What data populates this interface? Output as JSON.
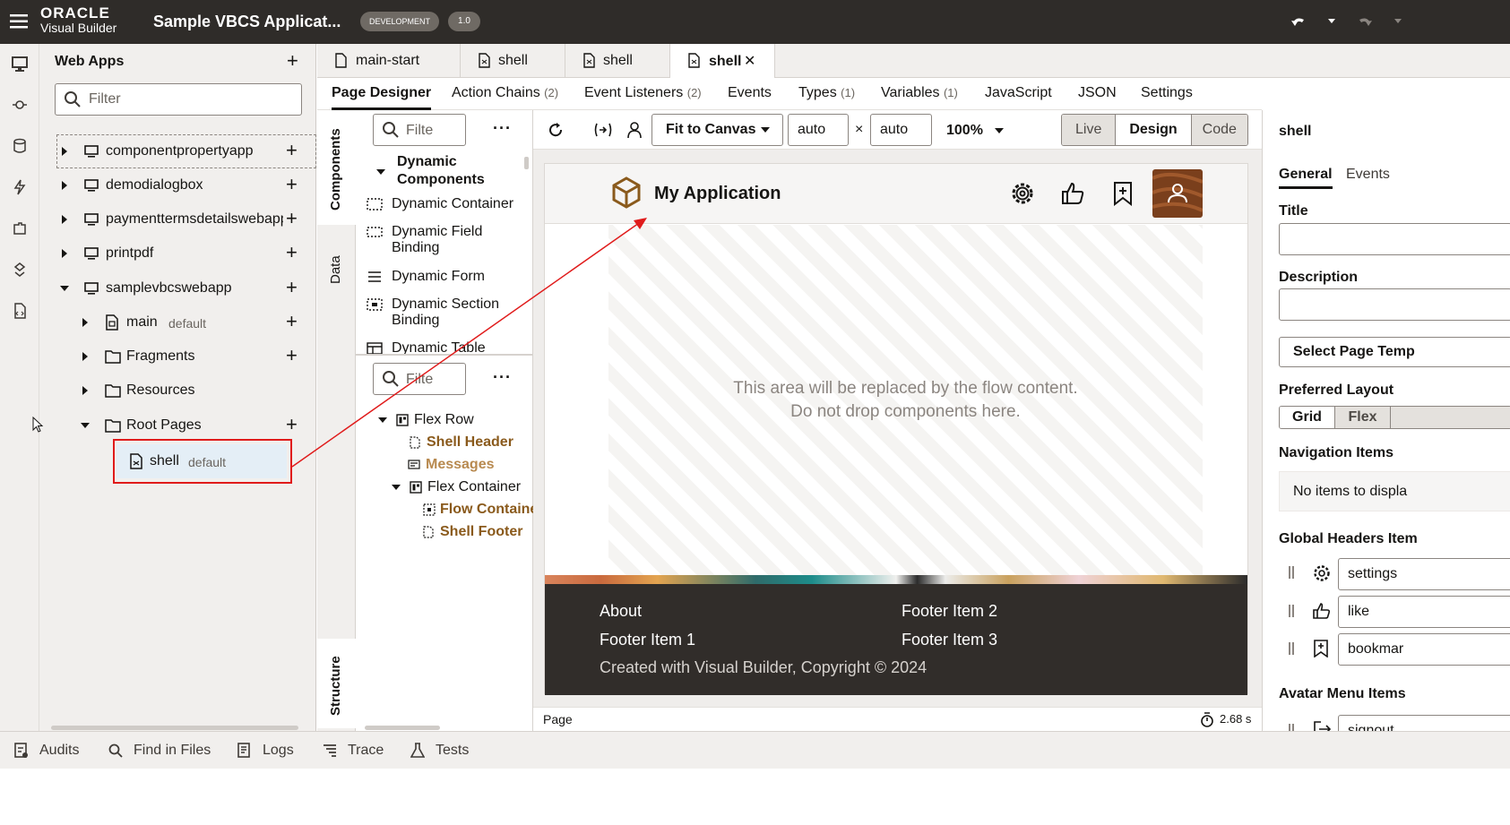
{
  "header": {
    "logo_line1": "ORACLE",
    "logo_line2": "Visual Builder",
    "app_title": "Sample VBCS Applicat...",
    "env_badge": "DEVELOPMENT",
    "version_badge": "1.0"
  },
  "left_panel": {
    "title": "Web Apps",
    "filter_placeholder": "Filter",
    "tree": [
      {
        "label": "componentpropertyapp"
      },
      {
        "label": "demodialogbox"
      },
      {
        "label": "paymenttermsdetailswebapp"
      },
      {
        "label": "printpdf"
      },
      {
        "label": "samplevbcswebapp"
      },
      {
        "label": "main",
        "tag": "default"
      },
      {
        "label": "Fragments"
      },
      {
        "label": "Resources"
      },
      {
        "label": "Root Pages"
      },
      {
        "label": "shell",
        "tag": "default"
      }
    ]
  },
  "file_tabs": [
    {
      "label": "main-start"
    },
    {
      "label": "shell"
    },
    {
      "label": "shell"
    },
    {
      "label": "shell",
      "active": true
    }
  ],
  "sub_tabs": [
    {
      "label": "Page Designer",
      "active": true
    },
    {
      "label": "Action Chains",
      "count": "(2)"
    },
    {
      "label": "Event Listeners",
      "count": "(2)"
    },
    {
      "label": "Events"
    },
    {
      "label": "Types",
      "count": "(1)"
    },
    {
      "label": "Variables",
      "count": "(1)"
    },
    {
      "label": "JavaScript"
    },
    {
      "label": "JSON"
    },
    {
      "label": "Settings"
    }
  ],
  "vertical_tabs": {
    "components": "Components",
    "data": "Data",
    "structure": "Structure"
  },
  "palette": {
    "filter_placeholder": "Filte",
    "section": "Dynamic Components",
    "items": [
      "Dynamic Container",
      "Dynamic Field Binding",
      "Dynamic Form",
      "Dynamic Section Binding",
      "Dynamic Table"
    ]
  },
  "structure": {
    "filter_placeholder": "Filte",
    "items": [
      "Flex Row",
      "Shell Header",
      "Messages",
      "Flex Container",
      "Flow Container",
      "Shell Footer"
    ]
  },
  "toolbar": {
    "fit": "Fit to Canvas",
    "width": "auto",
    "times": "×",
    "height": "auto",
    "zoom": "100%",
    "modes": [
      "Live",
      "Design",
      "Code"
    ]
  },
  "canvas": {
    "app_name": "My Application",
    "placeholder_line1": "This area will be replaced by the flow content.",
    "placeholder_line2": "Do not drop components here.",
    "footer_links": [
      "About",
      "Footer Item 2",
      "Footer Item 1",
      "Footer Item 3"
    ],
    "copyright": "Created with Visual Builder, Copyright © 2024"
  },
  "status": {
    "crumb": "Page",
    "timer": "2.68 s"
  },
  "properties": {
    "title": "shell",
    "tabs": [
      "General",
      "Events"
    ],
    "title_label": "Title",
    "description_label": "Description",
    "select_template": "Select Page Temp",
    "preferred_layout": "Preferred Layout",
    "layout_options": [
      "Grid",
      "Flex"
    ],
    "nav_items": "Navigation Items",
    "no_items": "No items to displa",
    "global_headers": "Global Headers Item",
    "headers": [
      "settings",
      "like",
      "bookmar"
    ],
    "avatar_menu": "Avatar Menu Items",
    "avatar_items": [
      "signout"
    ]
  },
  "bottom": [
    "Audits",
    "Find in Files",
    "Logs",
    "Trace",
    "Tests"
  ],
  "colors": {
    "accent": "#8a5a1c",
    "annotation": "#e01b1b",
    "footer_bg": "#312d2a"
  }
}
